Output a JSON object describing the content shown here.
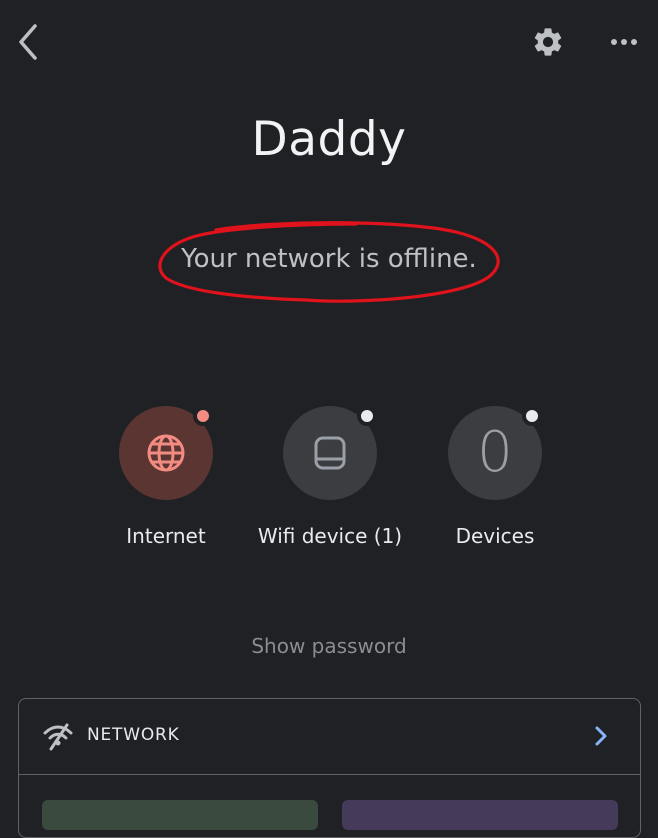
{
  "header": {
    "back_icon": "chevron-left-icon",
    "settings_icon": "gear-icon",
    "more_icon": "more-horizontal-icon"
  },
  "title": "Daddy",
  "status": {
    "text": "Your network is offline.",
    "annotation_color": "#e0121b"
  },
  "tiles": [
    {
      "label": "Internet",
      "icon": "globe-icon",
      "status_dot_color": "#f28b82"
    },
    {
      "label": "Wifi device (1)",
      "icon": "wifi-point-icon",
      "status_dot_color": "#e8eaed"
    },
    {
      "label": "Devices",
      "count": "0",
      "status_dot_color": "#e8eaed"
    }
  ],
  "show_password": "Show password",
  "network_card": {
    "label": "NETWORK",
    "icon": "wifi-off-icon",
    "chevron_icon": "chevron-right-icon",
    "chevron_color": "#8ab4f8"
  },
  "colors": {
    "background": "#202124",
    "accent_red": "#f28b82",
    "accent_blue": "#8ab4f8"
  }
}
